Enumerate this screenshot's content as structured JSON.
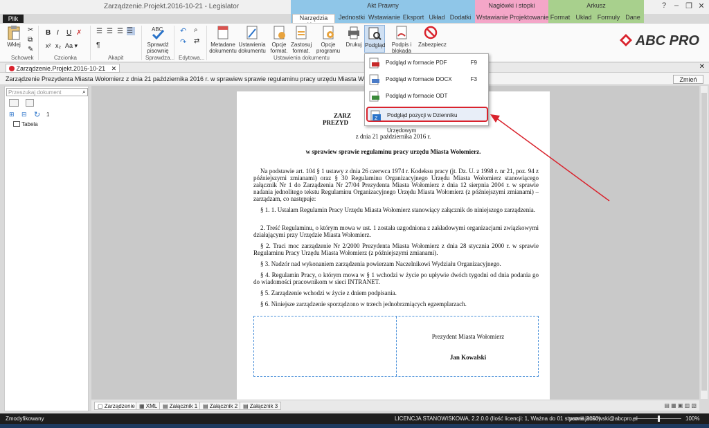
{
  "window": {
    "title": "Zarządzenie.Projekt.2016-10-21 - Legislator"
  },
  "context_groups": [
    {
      "label": "Akt Prawny",
      "tabs": [
        "Narzędzia główne",
        "Jednostki",
        "Wstawianie",
        "Eksport",
        "Układ",
        "Dodatki"
      ]
    },
    {
      "label": "Nagłówki i stopki",
      "tabs": [
        "Wstawianie",
        "Projektowanie"
      ]
    },
    {
      "label": "Arkusz",
      "tabs": [
        "Format",
        "Układ",
        "Formuły",
        "Dane"
      ]
    }
  ],
  "file_tab": "Plik",
  "ribbon": {
    "wklej": "Wklej",
    "schowek": "Schowek",
    "czcionka": "Czcionka",
    "akapit": "Akapit",
    "sprawdz": "Sprawdź pisownię",
    "sprawdzanie": "Sprawdza...",
    "edytowanie": "Edytowa...",
    "metadane": "Metadane dokumentu",
    "ustawienia": "Ustawienia dokumentu",
    "opcje_format": "Opcje format.",
    "zastosuj_format": "Zastosuj format.",
    "opcje_programu": "Opcje programu",
    "drukuj": "Drukuj",
    "podglad": "Podgląd",
    "podpis": "Podpis i blokada",
    "zabezpiecz": "Zabezpiecz",
    "ustawienia_dok_group": "Ustawienia dokumentu"
  },
  "logo": "ABC PRO",
  "doc_tab": "Zarządzenie.Projekt.2016-10-21",
  "info_line": "Zarządzenie Prezydenta Miasta Wołomierz z dnia 21 października 2016 r. w sprawiew sprawie regulaminu pracy urzędu Miasta Wołomierz.",
  "change_button": "Zmień",
  "left_pane": {
    "search_placeholder": "Przeszukaj dokument",
    "counter": "1",
    "tree_item": "Tabela"
  },
  "document": {
    "title_1": "ZARZ",
    "title_2": "PREZYD",
    "date": "z dnia 21 października 2016 r.",
    "subject": "w sprawiew sprawie regulaminu pracy urzędu Miasta Wołomierz.",
    "intro": "Na podstawie art. 104 § 1 ustawy z dnia 26 czerwca 1974 r. Kodeksu pracy (jt. Dz. U. z 1998 r. nr 21, poz. 94 z późniejszymi zmianami) oraz § 30 Regulaminu Organizacyjnego Urzędu Miasta Wołomierz stanowiącego załącznik Nr 1 do Zarządzenia Nr 27/04 Prezydenta Miasta Wołomierz z dnia 12 sierpnia 2004 r. w sprawie nadania jednolitego tekstu Regulaminu Organizacyjnego Urzędu Miasta Wołomierz (z późniejszymi zmianami) – zarządzam, co następuje:",
    "p1": "§ 1. 1. Ustalam Regulamin Pracy Urzędu Miasta Wołomierz stanowiący załącznik do niniejszego zarządzenia.",
    "p1_2": "2. Treść Regulaminu, o którym mowa w ust. 1 została uzgodniona z zakładowymi organizacjami związkowymi działającymi przy Urzędzie Miasta Wołomierz.",
    "p2": "§ 2. Traci moc zarządzenie Nr 2/2000 Prezydenta Miasta Wołomierz z dnia 28 stycznia 2000 r. w sprawie Regulaminu Pracy Urzędu Miasta Wołomierz (z późniejszymi zmianami).",
    "p3": "§ 3. Nadzór nad wykonaniem zarządzenia powierzam Naczelnikowi Wydziału Organizacyjnego.",
    "p4": "§ 4. Regulamin Pracy, o którym mowa w § 1 wchodzi w życie po upływie dwóch tygodni od dnia podania go do wiadomości pracownikom w sieci INTRANET.",
    "p5": "§ 5. Zarządzenie wchodzi w życie z dniem podpisania.",
    "p6": "§ 6. Niniejsze zarządzenie sporządzono w trzech jednobrzmiących egzemplarzach.",
    "sig_title": "Prezydent Miasta Wołomierz",
    "sig_name": "Jan Kowalski"
  },
  "dropdown": [
    {
      "label": "Podgląd w formacie PDF",
      "shortcut": "F9",
      "icon": "pdf-icon"
    },
    {
      "label": "Podgląd w formacie DOCX",
      "shortcut": "F3",
      "icon": "docx-icon"
    },
    {
      "label": "Podgląd w formacie ODT",
      "shortcut": "",
      "icon": "odt-icon"
    },
    {
      "label": "Podgląd pozycji w Dzienniku Urzędowym",
      "shortcut": "",
      "icon": "dziennik-icon"
    }
  ],
  "bottom_tabs": [
    "Zarządzenie",
    "XML",
    "Załącznik 1",
    "Załącznik 2",
    "Załącznik 3"
  ],
  "status": {
    "left": "Zmodyfikowany",
    "license": "LICENCJA STANOWISKOWA, 2.2.0.0 (Ilość licencji: 1, Ważna do 01 stycznia 2050)",
    "user": "pawel.jankowski@abcpro.pl",
    "zoom": "100%"
  },
  "colors": {
    "accent": "#d9232d",
    "ribbon_group1": "#8fc6e8",
    "ribbon_group2": "#f4a6c8",
    "ribbon_group3": "#a8d08d"
  }
}
